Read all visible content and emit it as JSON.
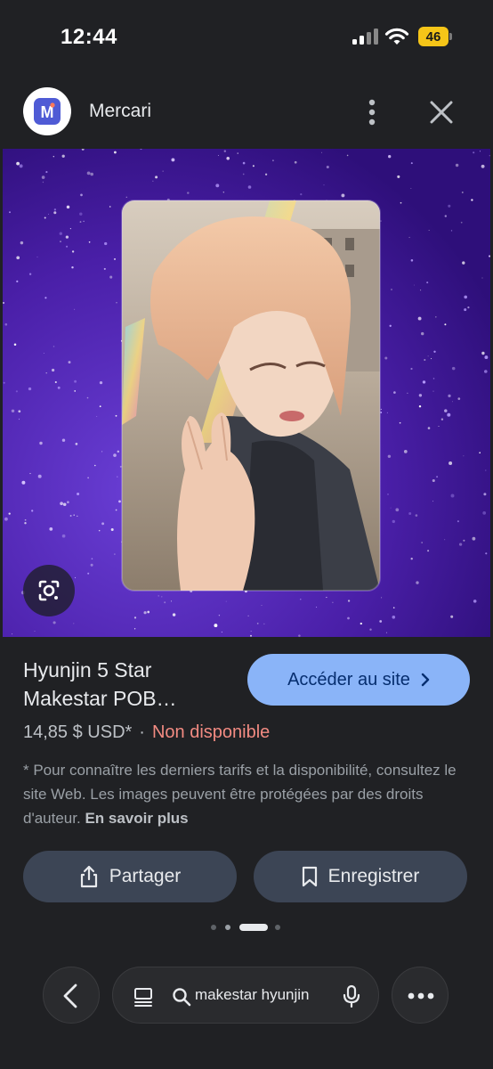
{
  "status_bar": {
    "time": "12:44",
    "battery_level": "46",
    "icons": [
      "signal-icon",
      "wifi-icon",
      "battery-icon"
    ]
  },
  "header": {
    "site_name": "Mercari",
    "logo_letter": "M",
    "icons": [
      "mercari-logo-icon",
      "more-vert-icon",
      "close-icon"
    ]
  },
  "hero": {
    "icons": [
      "lens-search-icon"
    ]
  },
  "result": {
    "title": "Hyunjin 5 Star Makestar POB…",
    "visit_label": "Accéder au site",
    "price": "14,85 $ USD*",
    "separator": "·",
    "availability": "Non disponible",
    "disclaimer": "* Pour connaître les derniers tarifs et la disponibilité, consultez le site Web. Les images peuvent être protégées par des droits d'auteur.",
    "learn_more": "En savoir plus"
  },
  "actions": {
    "share_label": "Partager",
    "save_label": "Enregistrer"
  },
  "pagination": {
    "total": 4,
    "active_index": 2
  },
  "bottom_bar": {
    "search_query": "makestar hyunjin",
    "icons": [
      "back-icon",
      "tabs-icon",
      "search-icon",
      "mic-icon",
      "more-horiz-icon"
    ]
  },
  "colors": {
    "background": "#202124",
    "accent_button": "#8ab4f8",
    "availability_red": "#f28b82",
    "action_button": "#3c4555",
    "battery": "#f5c518",
    "glitter_purple": "#4a1fa8"
  }
}
